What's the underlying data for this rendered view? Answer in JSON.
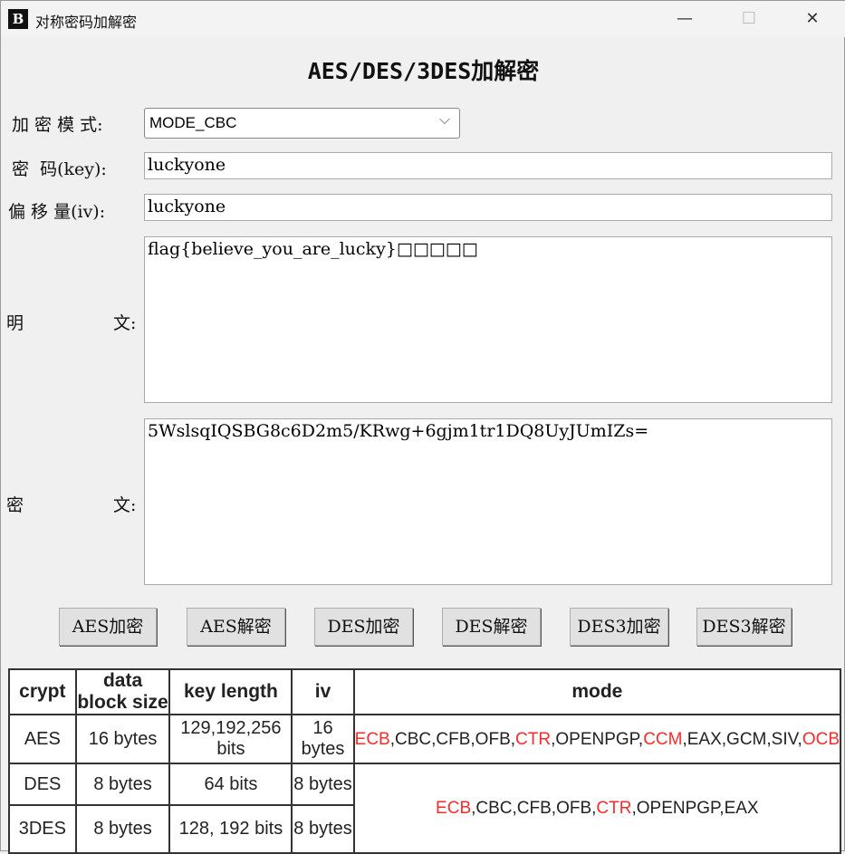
{
  "window": {
    "title": "对称密码加解密",
    "icon_text": "B",
    "minimize": "—",
    "maximize": "☐",
    "close": "✕"
  },
  "heading": "AES/DES/3DES加解密",
  "form": {
    "mode_label": "加 密 模 式:",
    "mode_value": "MODE_CBC",
    "key_label": "密  码(key):",
    "key_value": "luckyone",
    "iv_label": "偏 移 量(iv):",
    "iv_value": "luckyone",
    "plain_label_1": "明",
    "plain_label_2": "文:",
    "plain_value": "flag{believe_you_are_lucky}□□□□□",
    "cipher_label_1": "密",
    "cipher_label_2": "文:",
    "cipher_value": "5WslsqIQSBG8c6D2m5/KRwg+6gjm1tr1DQ8UyJUmIZs="
  },
  "buttons": [
    "AES加密",
    "AES解密",
    "DES加密",
    "DES解密",
    "DES3加密",
    "DES3解密"
  ],
  "table": {
    "headers": [
      "crypt",
      "data block size",
      "key length",
      "iv",
      "mode"
    ],
    "rows": [
      [
        "AES",
        "16 bytes",
        "129,192,256 bits",
        "16 bytes"
      ],
      [
        "DES",
        "8 bytes",
        "64 bits",
        "8 bytes"
      ],
      [
        "3DES",
        "8 bytes",
        "128, 192 bits",
        "8 bytes"
      ]
    ],
    "aes_mode": [
      {
        "t": "ECB",
        "red": true
      },
      {
        "t": ",CBC,CFB,OFB,",
        "red": false
      },
      {
        "t": "CTR",
        "red": true
      },
      {
        "t": ",OPENPGP,",
        "red": false
      },
      {
        "t": "CCM",
        "red": true
      },
      {
        "t": ",EAX,GCM,SIV,",
        "red": false
      },
      {
        "t": "OCB",
        "red": true
      }
    ],
    "des_mode": [
      {
        "t": "ECB",
        "red": true
      },
      {
        "t": ",CBC,CFB,OFB,",
        "red": false
      },
      {
        "t": "CTR",
        "red": true
      },
      {
        "t": ",OPENPGP,EAX",
        "red": false
      }
    ],
    "highlight_color": "#ff2a2a"
  }
}
